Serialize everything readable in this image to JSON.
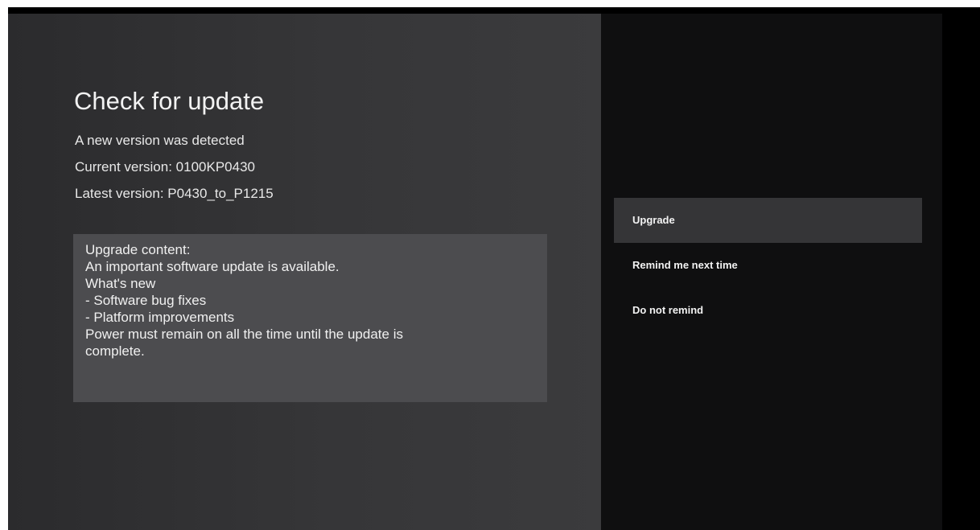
{
  "dialog": {
    "title": "Check for update",
    "status": "A new version was detected",
    "current_version": "Current version: 0100KP0430",
    "latest_version": "Latest version: P0430_to_P1215",
    "content_lines": [
      "Upgrade content:",
      "An important software update is available.",
      "What's new",
      "- Software bug fixes",
      "- Platform improvements",
      "Power must remain on all the time until the update is",
      "complete."
    ]
  },
  "menu": {
    "selected_index": 0,
    "items": [
      {
        "label": "Upgrade"
      },
      {
        "label": "Remind me next time"
      },
      {
        "label": "Do not remind"
      }
    ]
  },
  "colors": {
    "left_panel": "#363638",
    "right_panel": "#0f0f10",
    "content_box": "#4c4c4f",
    "selected_item": "#353537",
    "text": "#f2f2f2"
  }
}
